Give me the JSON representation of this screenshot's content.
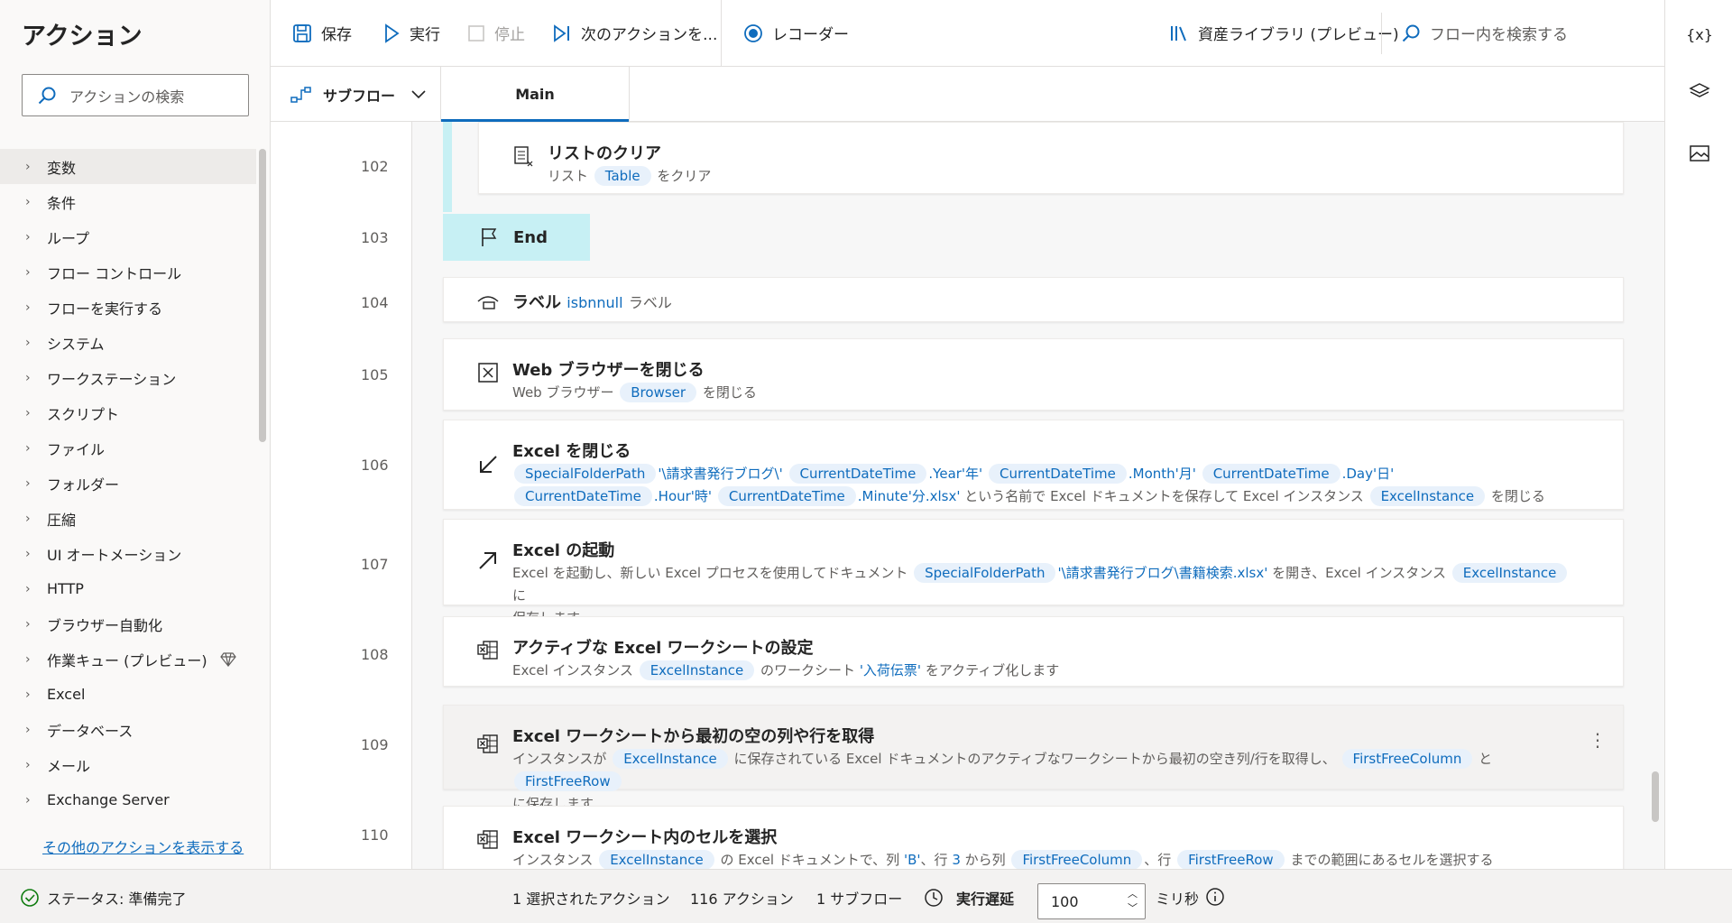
{
  "left": {
    "title": "アクション",
    "search_placeholder": "アクションの検索",
    "categories": [
      "変数",
      "条件",
      "ループ",
      "フロー コントロール",
      "フローを実行する",
      "システム",
      "ワークステーション",
      "スクリプト",
      "ファイル",
      "フォルダー",
      "圧縮",
      "UI オートメーション",
      "HTTP",
      "ブラウザー自動化",
      "作業キュー (プレビュー)",
      "Excel",
      "データベース",
      "メール",
      "Exchange Server"
    ],
    "more_link": "その他のアクションを表示する"
  },
  "toolbar": {
    "save": "保存",
    "run": "実行",
    "stop": "停止",
    "next": "次のアクションを...",
    "recorder": "レコーダー",
    "assets": "資産ライブラリ (プレビュー)",
    "search_placeholder": "フロー内を検索する"
  },
  "subbar": {
    "subflow": "サブフロー",
    "main_tab": "Main"
  },
  "rail": {
    "variables": "{x}"
  },
  "flow": {
    "rows": [
      {
        "no": "102",
        "title": "リストのクリア",
        "d1": "リスト",
        "t1": "Table",
        "d2": "をクリア"
      },
      {
        "no": "103",
        "title": "End"
      },
      {
        "no": "104",
        "title": "ラベル",
        "t1": "isbnnull",
        "d1": "ラベル"
      },
      {
        "no": "105",
        "title": "Web ブラウザーを閉じる",
        "d1": "Web ブラウザー",
        "t1": "Browser",
        "d2": "を閉じる"
      },
      {
        "no": "106",
        "title": "Excel を閉じる",
        "t1": "SpecialFolderPath",
        "s1": "'\\請求書発行ブログ\\'",
        "t2": "CurrentDateTime",
        "s2": ".Year'年'",
        "t3": "CurrentDateTime",
        "s3": ".Month'月'",
        "t4": "CurrentDateTime",
        "s4": ".Day'日'",
        "t5": "CurrentDateTime",
        "s5": ".Hour'時'",
        "t6": "CurrentDateTime",
        "s6": ".Minute'分.xlsx'",
        "d1": "という名前で Excel ドキュメントを保存して Excel インスタンス",
        "t7": "ExcelInstance",
        "d2": "を閉じる"
      },
      {
        "no": "107",
        "title": "Excel の起動",
        "d1": "Excel を起動し、新しい Excel プロセスを使用してドキュメント",
        "t1": "SpecialFolderPath",
        "s1": "'\\請求書発行ブログ\\書籍検索.xlsx'",
        "d2": "を開き、Excel インスタンス",
        "t2": "ExcelInstance",
        "d3": "に",
        "d4": "保存します。"
      },
      {
        "no": "108",
        "title": "アクティブな Excel ワークシートの設定",
        "d1": "Excel インスタンス",
        "t1": "ExcelInstance",
        "d2": "のワークシート",
        "s1": "'入荷伝票'",
        "d3": "をアクティブ化します"
      },
      {
        "no": "109",
        "title": "Excel ワークシートから最初の空の列や行を取得",
        "d1": "インスタンスが",
        "t1": "ExcelInstance",
        "d2": "に保存されている Excel ドキュメントのアクティブなワークシートから最初の空き列/行を取得し、",
        "t2": "FirstFreeColumn",
        "d3": "と",
        "t3": "FirstFreeRow",
        "d4": "に保存します"
      },
      {
        "no": "110",
        "title": "Excel ワークシート内のセルを選択",
        "d1": "インスタンス",
        "t1": "ExcelInstance",
        "d2": "の Excel ドキュメントで、列",
        "s1": "'B'",
        "d3": "、行",
        "s2": "3",
        "d4": "から列",
        "t2": "FirstFreeColumn",
        "d5": "、行",
        "t3": "FirstFreeRow",
        "d6": "までの範囲にあるセルを選択する"
      }
    ]
  },
  "status": {
    "state": "ステータス: 準備完了",
    "selected": "1 選択されたアクション",
    "actions": "116 アクション",
    "subflows": "1 サブフロー",
    "delay_label": "実行遅延",
    "delay_value": "100",
    "unit": "ミリ秒"
  },
  "colors": {
    "accent": "#0f6cbd",
    "token_bg": "#e8f1fb",
    "end_bg": "#c7f0f4"
  }
}
